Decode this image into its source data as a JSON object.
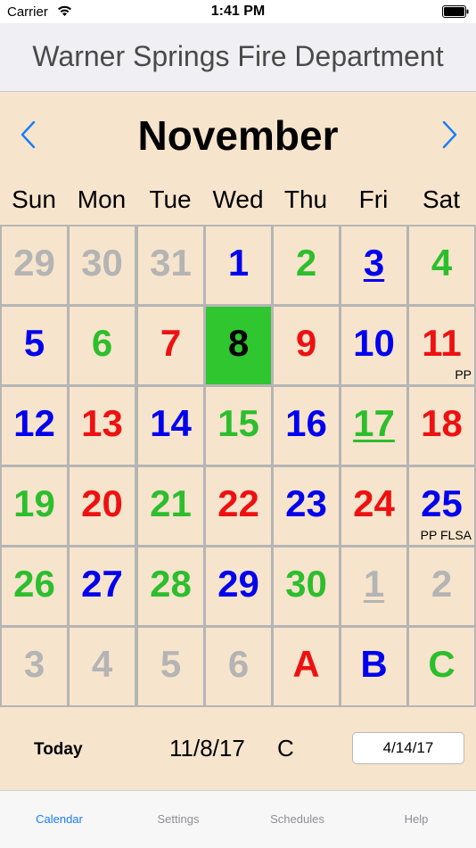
{
  "status_bar": {
    "carrier": "Carrier",
    "time": "1:41 PM"
  },
  "nav": {
    "title": "Warner Springs Fire Department"
  },
  "calendar": {
    "month": "November",
    "weekdays": [
      "Sun",
      "Mon",
      "Tue",
      "Wed",
      "Thu",
      "Fri",
      "Sat"
    ],
    "colors": {
      "gray": "#b4b4b4",
      "blue": "#0000ee",
      "green": "#2dbe2d",
      "red": "#ee1111",
      "black": "#000000",
      "selected_bg": "#2fc630"
    },
    "rows": [
      [
        {
          "label": "29",
          "color": "gray"
        },
        {
          "label": "30",
          "color": "gray"
        },
        {
          "label": "31",
          "color": "gray"
        },
        {
          "label": "1",
          "color": "blue"
        },
        {
          "label": "2",
          "color": "green"
        },
        {
          "label": "3",
          "color": "blue",
          "underline": true
        },
        {
          "label": "4",
          "color": "green"
        }
      ],
      [
        {
          "label": "5",
          "color": "blue"
        },
        {
          "label": "6",
          "color": "green"
        },
        {
          "label": "7",
          "color": "red"
        },
        {
          "label": "8",
          "color": "black",
          "selected": true
        },
        {
          "label": "9",
          "color": "red"
        },
        {
          "label": "10",
          "color": "blue"
        },
        {
          "label": "11",
          "color": "red",
          "note": "PP"
        }
      ],
      [
        {
          "label": "12",
          "color": "blue"
        },
        {
          "label": "13",
          "color": "red"
        },
        {
          "label": "14",
          "color": "blue"
        },
        {
          "label": "15",
          "color": "green"
        },
        {
          "label": "16",
          "color": "blue"
        },
        {
          "label": "17",
          "color": "green",
          "underline": true
        },
        {
          "label": "18",
          "color": "red"
        }
      ],
      [
        {
          "label": "19",
          "color": "green"
        },
        {
          "label": "20",
          "color": "red"
        },
        {
          "label": "21",
          "color": "green"
        },
        {
          "label": "22",
          "color": "red"
        },
        {
          "label": "23",
          "color": "blue"
        },
        {
          "label": "24",
          "color": "red"
        },
        {
          "label": "25",
          "color": "blue",
          "note": "PP FLSA"
        }
      ],
      [
        {
          "label": "26",
          "color": "green"
        },
        {
          "label": "27",
          "color": "blue"
        },
        {
          "label": "28",
          "color": "green"
        },
        {
          "label": "29",
          "color": "blue"
        },
        {
          "label": "30",
          "color": "green"
        },
        {
          "label": "1",
          "color": "gray",
          "underline": true
        },
        {
          "label": "2",
          "color": "gray"
        }
      ],
      [
        {
          "label": "3",
          "color": "gray"
        },
        {
          "label": "4",
          "color": "gray"
        },
        {
          "label": "5",
          "color": "gray"
        },
        {
          "label": "6",
          "color": "gray"
        },
        {
          "label": "A",
          "color": "red"
        },
        {
          "label": "B",
          "color": "blue"
        },
        {
          "label": "C",
          "color": "green"
        }
      ]
    ]
  },
  "footer": {
    "today_label": "Today",
    "current_date": "11/8/17",
    "shift": "C",
    "date_box": "4/14/17"
  },
  "tabs": [
    {
      "label": "Calendar",
      "active": true
    },
    {
      "label": "Settings",
      "active": false
    },
    {
      "label": "Schedules",
      "active": false
    },
    {
      "label": "Help",
      "active": false
    }
  ],
  "accent_color": "#157efb"
}
